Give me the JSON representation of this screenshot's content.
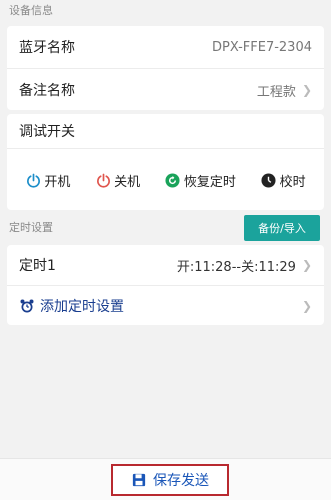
{
  "device_section": {
    "label": "设备信息",
    "bluetooth_name_label": "蓝牙名称",
    "bluetooth_name_value": "DPX-FFE7-2304",
    "remark_label": "备注名称",
    "remark_value": "工程款"
  },
  "debug_section": {
    "title": "调试开关",
    "controls": [
      {
        "label": "开机",
        "icon": "power-icon",
        "color": "#1c8ec9"
      },
      {
        "label": "关机",
        "icon": "power-icon",
        "color": "#e0554d"
      },
      {
        "label": "恢复定时",
        "icon": "restore-icon",
        "color": "#1aa35a"
      },
      {
        "label": "校时",
        "icon": "clock-icon",
        "color": "#222222"
      }
    ]
  },
  "timer_section": {
    "label": "定时设置",
    "backup_button": "备份/导入",
    "timers": [
      {
        "name": "定时1",
        "value": "开:11:28--关:11:29"
      }
    ],
    "add_label": "添加定时设置"
  },
  "footer": {
    "save_label": "保存发送"
  },
  "colors": {
    "accent_teal": "#1ba39c",
    "highlight_red": "#b8292f",
    "link_blue": "#1a3e8f"
  }
}
